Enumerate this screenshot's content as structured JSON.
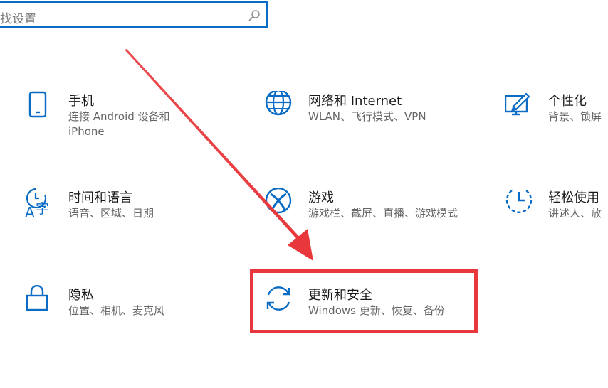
{
  "search": {
    "placeholder": "找设置"
  },
  "tiles": [
    {
      "title": "手机",
      "desc": "连接 Android 设备和 iPhone",
      "icon": "phone-icon"
    },
    {
      "title": "网络和 Internet",
      "desc": "WLAN、飞行模式、VPN",
      "icon": "globe-icon"
    },
    {
      "title": "个性化",
      "desc": "背景、锁屏",
      "icon": "personalization-icon"
    },
    {
      "title": "时间和语言",
      "desc": "语音、区域、日期",
      "icon": "time-language-icon"
    },
    {
      "title": "游戏",
      "desc": "游戏栏、截屏、直播、游戏模式",
      "icon": "xbox-icon"
    },
    {
      "title": "轻松使用",
      "desc": "讲述人、放",
      "icon": "ease-of-access-icon"
    },
    {
      "title": "隐私",
      "desc": "位置、相机、麦克风",
      "icon": "lock-icon"
    },
    {
      "title": "更新和安全",
      "desc": "Windows 更新、恢复、备份",
      "icon": "sync-icon"
    }
  ],
  "colors": {
    "accent": "#0a6cc4",
    "annotation": "#e8383b",
    "title_text": "#1a1a1a",
    "desc_text": "#666666"
  }
}
